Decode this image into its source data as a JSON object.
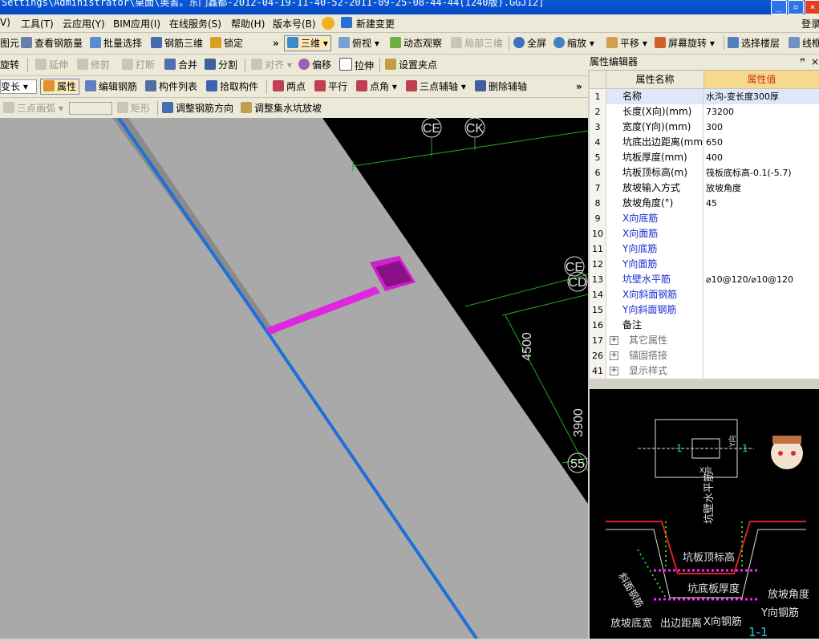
{
  "window": {
    "title": "Settings\\Administrator\\桌面\\奥耆。东门鑫都-2012-04-19-11-40-52-2011-09-25-08-44-44(1240版).GGJ12]"
  },
  "menu": [
    "V)",
    "工具(T)",
    "云应用(Y)",
    "BIM应用(I)",
    "在线服务(S)",
    "帮助(H)",
    "版本号(B)",
    "新建变更",
    "登录"
  ],
  "toolbar1": {
    "items": [
      "图元",
      "查看钢筋量",
      "批量选择",
      "钢筋三维",
      "锁定",
      "三维",
      "俯视",
      "动态观察",
      "局部三维",
      "全屏",
      "缩放",
      "平移",
      "屏幕旋转",
      "选择楼层",
      "线框"
    ],
    "overflow": "»"
  },
  "toolbar2": {
    "items": [
      "旋转",
      "延伸",
      "修剪",
      "打断",
      "合并",
      "分割",
      "对齐",
      "偏移",
      "拉伸",
      "设置夹点"
    ]
  },
  "toolbar3": {
    "dropdown": "变长",
    "items": [
      "属性",
      "编辑钢筋",
      "构件列表",
      "拾取构件",
      "两点",
      "平行",
      "点角",
      "三点辅轴",
      "删除辅轴"
    ],
    "overflow": "»"
  },
  "toolbar4": {
    "items": [
      "三点画弧",
      "矩形",
      "调整钢筋方向",
      "调整集水坑放坡"
    ]
  },
  "canvas": {
    "labels": [
      "CE",
      "CK",
      "CE",
      "CD",
      "4500",
      "3900",
      "55"
    ]
  },
  "props": {
    "panel_title": "属性编辑器",
    "pin": "ꟸ",
    "col_name": "属性名称",
    "col_value": "属性值",
    "rows": [
      {
        "num": "1",
        "name": "名称",
        "value": "水沟-变长度300厚"
      },
      {
        "num": "2",
        "name": "长度(X向)(mm)",
        "value": "73200"
      },
      {
        "num": "3",
        "name": "宽度(Y向)(mm)",
        "value": "300"
      },
      {
        "num": "4",
        "name": "坑底出边距离(mm)",
        "value": "650"
      },
      {
        "num": "5",
        "name": "坑板厚度(mm)",
        "value": "400"
      },
      {
        "num": "6",
        "name": "坑板顶标高(m)",
        "value": "筏板底标高-0.1(-5.7)"
      },
      {
        "num": "7",
        "name": "放坡输入方式",
        "value": "放坡角度"
      },
      {
        "num": "8",
        "name": "放坡角度(°)",
        "value": "45"
      },
      {
        "num": "9",
        "name": "X向底筋",
        "value": ""
      },
      {
        "num": "10",
        "name": "X向面筋",
        "value": ""
      },
      {
        "num": "11",
        "name": "Y向底筋",
        "value": ""
      },
      {
        "num": "12",
        "name": "Y向面筋",
        "value": ""
      },
      {
        "num": "13",
        "name": "坑壁水平筋",
        "value": "⌀10@120/⌀10@120"
      },
      {
        "num": "14",
        "name": "X向斜面钢筋",
        "value": ""
      },
      {
        "num": "15",
        "name": "Y向斜面钢筋",
        "value": ""
      },
      {
        "num": "16",
        "name": "备注",
        "value": ""
      },
      {
        "num": "17",
        "name": "其它属性",
        "value": ""
      },
      {
        "num": "26",
        "name": "锚固搭接",
        "value": ""
      },
      {
        "num": "41",
        "name": "显示样式",
        "value": ""
      }
    ]
  },
  "diagram": {
    "labels": [
      "1",
      "1",
      "Y向",
      "X向",
      "坑壁水平筋",
      "坑板顶标高",
      "斜面钢筋",
      "坑底板厚度",
      "放坡角度",
      "Y向钢筋",
      "放坡底宽",
      "出边距离",
      "X向钢筋",
      "1-1"
    ]
  }
}
